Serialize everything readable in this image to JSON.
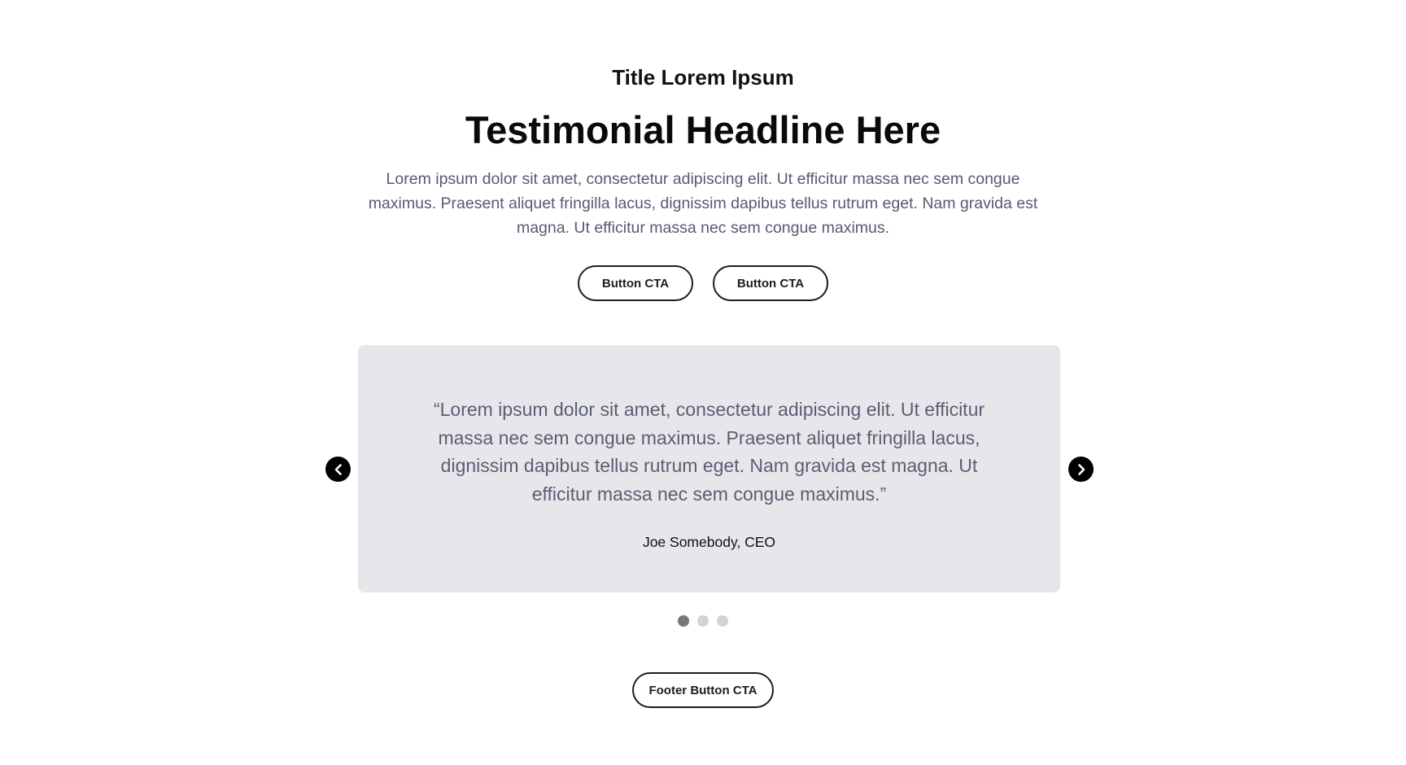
{
  "header": {
    "eyebrow": "Title Lorem Ipsum",
    "headline": "Testimonial Headline Here",
    "intro": "Lorem ipsum dolor sit amet, consectetur adipiscing elit. Ut efficitur massa nec sem congue maximus. Praesent aliquet fringilla lacus, dignissim dapibus tellus rutrum eget. Nam gravida est magna. Ut efficitur massa nec sem congue maximus."
  },
  "ctas": [
    {
      "label": "Button CTA"
    },
    {
      "label": "Button CTA"
    }
  ],
  "testimonial": {
    "quote": "“Lorem ipsum dolor sit amet, consectetur adipiscing elit. Ut efficitur massa nec sem congue maximus. Praesent aliquet fringilla lacus, dignissim dapibus tellus rutrum eget. Nam gravida est magna. Ut efficitur massa nec sem congue maximus.”",
    "author": "Joe Somebody, CEO"
  },
  "carousel": {
    "prev_icon": "chevron-left-icon",
    "next_icon": "chevron-right-icon",
    "slide_count": 3,
    "active_slide": 1
  },
  "footer": {
    "cta_label": "Footer Button CTA"
  },
  "colors": {
    "background": "#ffffff",
    "card_background": "#e7e7eb",
    "body_text": "#565a70",
    "button_border": "#1c1c28",
    "dot_active": "#77777a",
    "dot_inactive": "#d3d3d6"
  }
}
